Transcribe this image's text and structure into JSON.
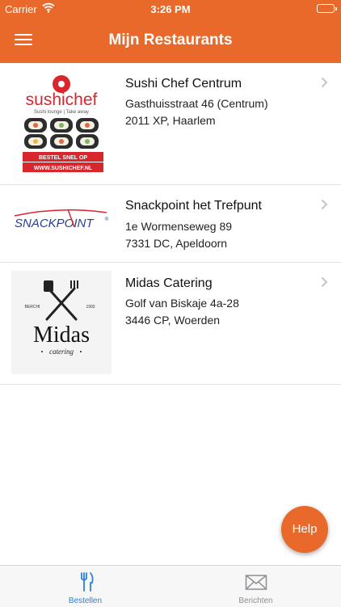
{
  "status_bar": {
    "carrier": "Carrier",
    "time": "3:26 PM",
    "wifi_icon": "wifi-icon",
    "battery_icon": "battery-icon"
  },
  "header": {
    "title": "Mijn Restaurants",
    "menu_icon": "hamburger-menu-icon"
  },
  "colors": {
    "accent": "#e8692a",
    "tab_active": "#2f7fd8",
    "tab_inactive": "#8e8e93"
  },
  "restaurants": [
    {
      "name": "Sushi Chef Centrum",
      "address_line1": "Gasthuisstraat 46 (Centrum)",
      "address_line2": "2011 XP, Haarlem",
      "logo": {
        "brand_text": "sushichef",
        "tagline": "Sushi lounge | Take away",
        "banner1": "BESTEL SNEL OP",
        "banner2": "WWW.SUSHICHEF.NL"
      }
    },
    {
      "name": "Snackpoint het Trefpunt",
      "address_line1": "1e Wormenseweg 89",
      "address_line2": "7331 DC, Apeldoorn",
      "logo": {
        "brand_text": "SNACKPOINT",
        "mark": "®"
      }
    },
    {
      "name": "Midas Catering",
      "address_line1": "Golf van Biskaje 4a-28",
      "address_line2": "3446 CP, Woerden",
      "logo": {
        "brand_text": "Midas",
        "sub_text": "catering",
        "left_mark": "BERCHI",
        "right_mark": "1993"
      }
    }
  ],
  "help_button": {
    "label": "Help"
  },
  "tab_bar": {
    "tabs": [
      {
        "label": "Bestellen",
        "icon": "fork-knife-icon",
        "active": true
      },
      {
        "label": "Berichten",
        "icon": "envelope-icon",
        "active": false
      }
    ]
  }
}
